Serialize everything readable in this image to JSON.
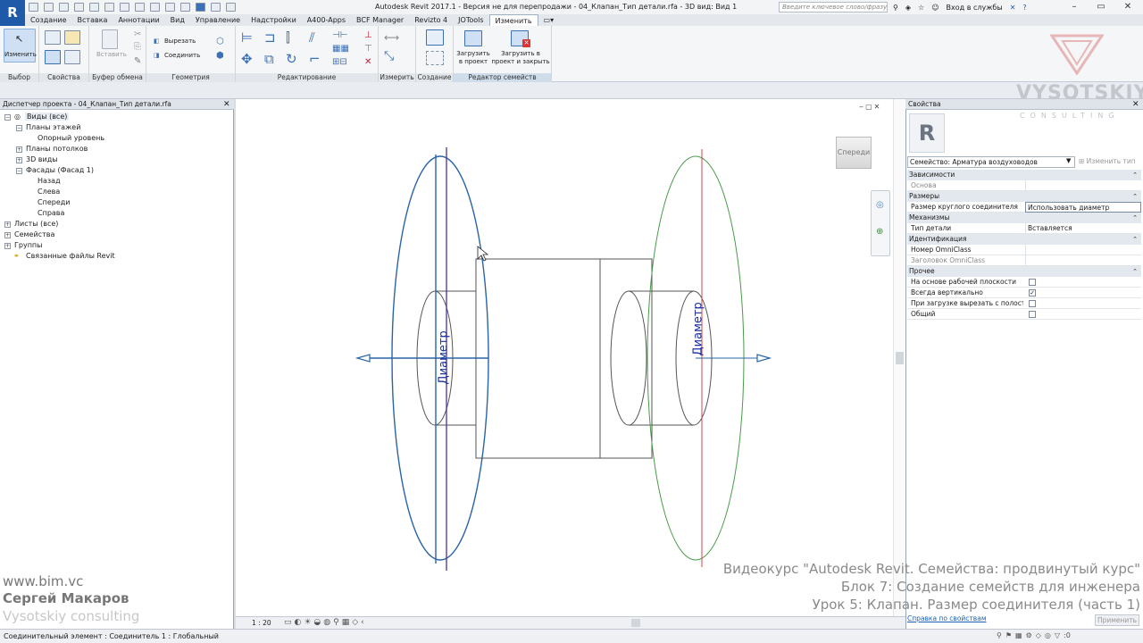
{
  "title_bar": {
    "text": "Autodesk Revit 2017.1 - Версия не для перепродажи -   04_Клапан_Тип детали.rfa - 3D вид: Вид 1",
    "search_placeholder": "Введите ключевое слово/фразу",
    "login": "Вход в службы"
  },
  "tabs": [
    "Создание",
    "Вставка",
    "Аннотации",
    "Вид",
    "Управление",
    "Надстройки",
    "A400-Apps",
    "BCF Manager",
    "Revizto 4",
    "JOTools",
    "Изменить"
  ],
  "active_tab": "Изменить",
  "ribbon": {
    "modify_label": "Изменить",
    "paste_label": "Вставить",
    "cut_label": "Вырезать",
    "join_label": "Соединить",
    "load_project_label": "Загрузить в проект",
    "load_close_label": "Загрузить в проект и закрыть",
    "panels": [
      "Выбор",
      "Свойства",
      "Буфер обмена",
      "Геометрия",
      "Редактирование",
      "Измерить",
      "Создание",
      "Редактор семейств"
    ]
  },
  "project_browser": {
    "title": "Диспетчер проекта - 04_Клапан_Тип детали.rfa",
    "nodes": [
      "Виды (все)",
      "Планы этажей",
      "Опорный уровень",
      "Планы потолков",
      "3D виды",
      "Фасады (Фасад 1)",
      "Назад",
      "Слева",
      "Спереди",
      "Справа",
      "Листы (все)",
      "Семейства",
      "Группы",
      "Связанные файлы Revit"
    ]
  },
  "canvas": {
    "view_cube_label": "Спереди",
    "dim_label_left": "Диаметр",
    "dim_label_right": "Диаметр",
    "scale": "1 : 20"
  },
  "properties": {
    "title": "Свойства",
    "family_selector": "Семейство: Арматура воздуховодов",
    "edit_type": "Изменить тип",
    "groups": {
      "constraints": "Зависимости",
      "dimensions": "Размеры",
      "mechanical": "Механизмы",
      "identity": "Идентификация",
      "other": "Прочее"
    },
    "rows": {
      "host": "Основа",
      "round_size": "Размер круглого соединителя",
      "round_size_value": "Использовать диаметр",
      "part_type": "Тип детали",
      "part_type_value": "Вставляется",
      "omniclass_num": "Номер OmniClass",
      "omniclass_title": "Заголовок OmniClass",
      "work_plane": "На основе рабочей плоскости",
      "always_vertical": "Всегда вертикально",
      "cut_on_load": "При загрузке вырезать с полост...",
      "shared": "Общий"
    },
    "help_link": "Справка по свойствам",
    "apply": "Применить"
  },
  "watermark": {
    "brand": "VYSOTSKIY",
    "consulting": "CONSULTING",
    "site": "www.bim.vc",
    "author": "Сергей Макаров",
    "company": "Vysotskiy consulting",
    "course_line1": "Видеокурс \"Autodesk Revit. Семейства: продвинутый курс\"",
    "course_line2": "Блок 7: Создание семейств для инженера",
    "course_line3": "Урок 5: Клапан. Размер соединителя (часть 1)"
  },
  "status_bar": {
    "text": "Соединительный элемент : Соединитель 1 : Глобальный",
    "filter_count": ":0"
  },
  "colors": {
    "revit_blue": "#1e5aa8",
    "blue_connector": "#2a64a8",
    "green_connector": "#4a9a4a",
    "red_axis": "#d04848",
    "purple_axis": "#5b3fa0"
  }
}
